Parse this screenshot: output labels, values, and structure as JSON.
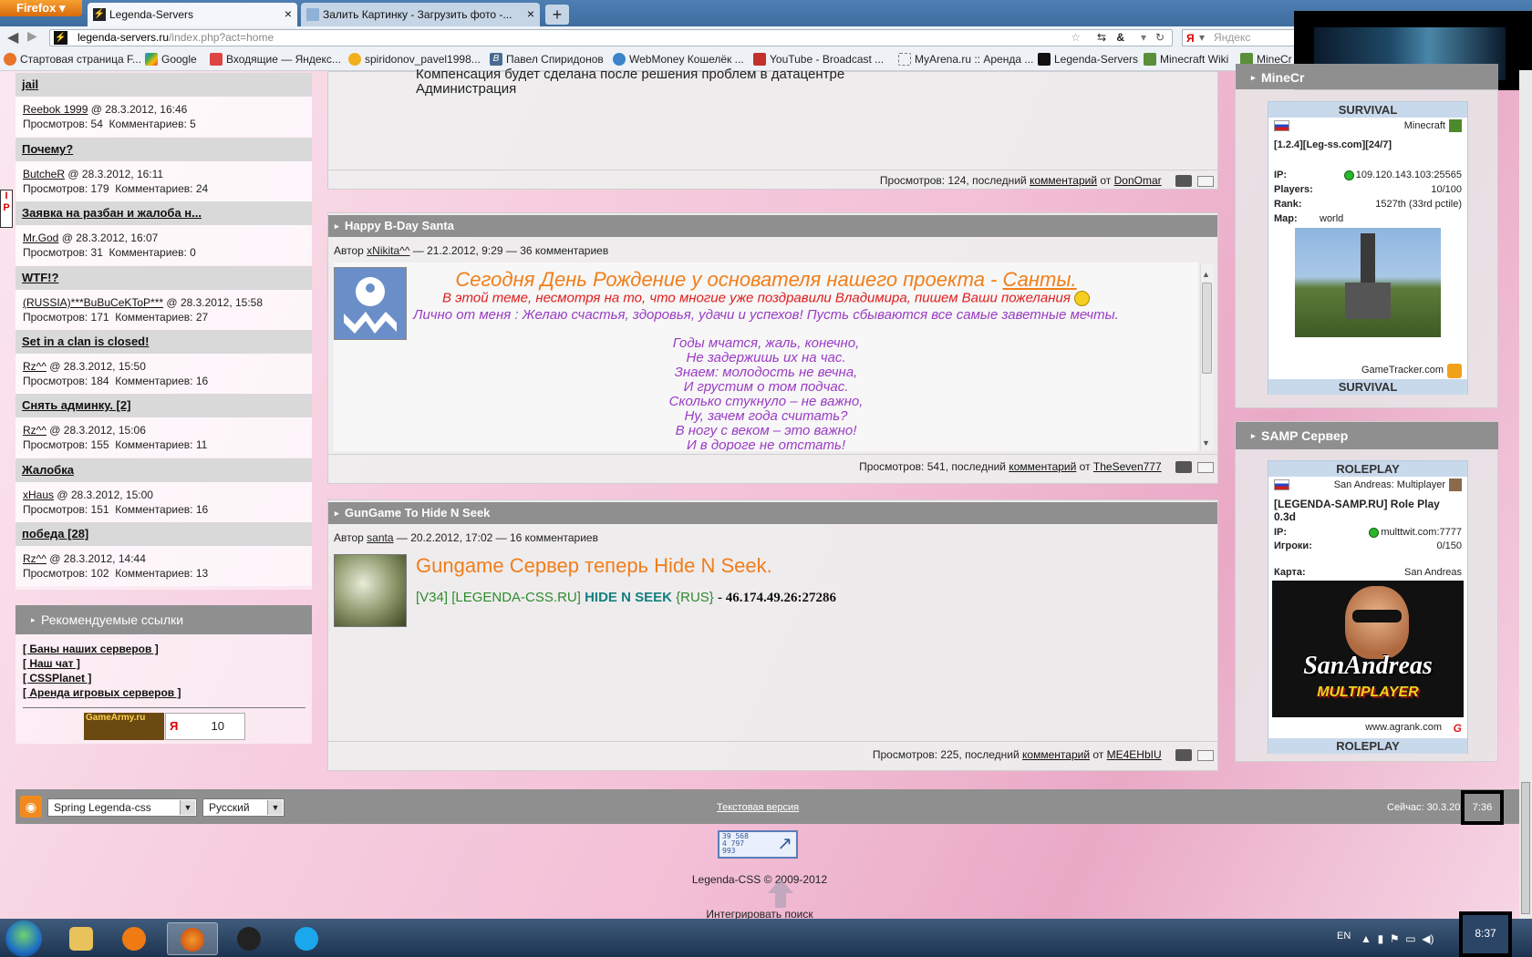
{
  "browser": {
    "firefox_label": "Firefox",
    "tabs": [
      {
        "title": "Legenda-Servers"
      },
      {
        "title": "Залить Картинку - Загрузить фото -..."
      }
    ],
    "url_host": "legenda-servers.ru",
    "url_path": "/index.php?act=home",
    "search_placeholder": "Яндекс",
    "bookmarks": [
      "Стартовая страница F...",
      "Google",
      "Входящие — Яндекс...",
      "spiridonov_pavel1998...",
      "Павел Спиридонов",
      "WebMoney Кошелёк ...",
      "YouTube - Broadcast ...",
      "MyArena.ru :: Аренда ...",
      "Legenda-Servers",
      "Minecraft Wiki",
      "MineCr"
    ]
  },
  "left": {
    "topics": [
      {
        "title": "jail",
        "author": "Reebok 1999",
        "date": "@ 28.3.2012, 16:46",
        "views": "Просмотров: 54",
        "comments": "Комментариев: 5"
      },
      {
        "title": "Почему?",
        "author": "ButcheR",
        "date": "@ 28.3.2012, 16:11",
        "views": "Просмотров: 179",
        "comments": "Комментариев: 24"
      },
      {
        "title": "Заявка на разбан и жалоба н...",
        "author": "Mr.God",
        "date": "@ 28.3.2012, 16:07",
        "views": "Просмотров: 31",
        "comments": "Комментариев: 0"
      },
      {
        "title": "WTF!?",
        "author": "(RUSSIA)***BuBuCeKToP***",
        "date": "@ 28.3.2012, 15:58",
        "views": "Просмотров: 171",
        "comments": "Комментариев: 27"
      },
      {
        "title": "Set in a clan is closed!",
        "author": "Rz^^",
        "date": "@ 28.3.2012, 15:50",
        "views": "Просмотров: 184",
        "comments": "Комментариев: 16"
      },
      {
        "title": "Снять админку. [2]",
        "author": "Rz^^",
        "date": "@ 28.3.2012, 15:06",
        "views": "Просмотров: 155",
        "comments": "Комментариев: 11"
      },
      {
        "title": "Жалобка",
        "author": "xHaus",
        "date": "@ 28.3.2012, 15:00",
        "views": "Просмотров: 151",
        "comments": "Комментариев: 16"
      },
      {
        "title": "победа [28]",
        "author": "Rz^^",
        "date": "@ 28.3.2012, 14:44",
        "views": "Просмотров: 102",
        "comments": "Комментариев: 13"
      }
    ],
    "recommended_title": "Рекомендуемые ссылки",
    "links": [
      "[ Баны наших серверов ]",
      "[ Наш чат ]",
      "[ CSSPlanet ]",
      "[ Аренда игровых серверов ]"
    ],
    "counter_gamearmy": "GameArmy.ru",
    "counter_num": "10"
  },
  "center": {
    "post1": {
      "line1": "Компенсация будет сделана после решения проблем в датацентре",
      "line2": "Администрация",
      "views": "Просмотров: 124, последний",
      "comment_link": "комментарий",
      "from": "от",
      "last_user": "DonOmar"
    },
    "post2": {
      "title": "Happy B-Day Santa",
      "author_label": "Автор",
      "author": "xNikita^^",
      "meta": "— 21.2.2012, 9:29 — 36 комментариев",
      "headline": "Сегодня День Рождение у основателя нашего проекта -",
      "headline_link": "Санты.",
      "red_line": "В этой теме, несмотря на то, что многие уже поздравили Владимира, пишем Ваши пожелания",
      "purple_line": "Лично от меня : Желаю счастья, здоровья, удачи и успехов! Пусть сбываются все самые заветные мечты.",
      "poem": [
        "Годы мчатся, жаль, конечно,",
        "Не задержишь их на час.",
        "Знаем: молодость не вечна,",
        "И грустим о том подчас.",
        "Сколько стукнуло – не важно,",
        "Ну, зачем года считать?",
        "В ногу с веком – это важно!",
        "И в дороге не отстать!"
      ],
      "views": "Просмотров: 541, последний",
      "comment_link": "комментарий",
      "from": "от",
      "last_user": "TheSeven777"
    },
    "post3": {
      "title": "GunGame To Hide N Seek",
      "author_label": "Автор",
      "author": "santa",
      "meta": "— 20.2.2012, 17:02 — 16 комментариев",
      "headline": "Gungame Сервер теперь Hide N Seek.",
      "tag1": "[V34]",
      "tag2": "[LEGENDA-CSS.RU]",
      "tag3": "HIDE N SEEK",
      "tag4": "{RUS}",
      "address": "- 46.174.49.26:27286",
      "views": "Просмотров: 225, последний",
      "comment_link": "комментарий",
      "from": "от",
      "last_user": "ME4EHbIU"
    }
  },
  "right": {
    "mc_head": "MineCr",
    "mc": {
      "title": "SURVIVAL",
      "game": "Minecraft",
      "name": "[1.2.4][Leg-ss.com][24/7]",
      "ip_label": "IP:",
      "ip": "109.120.143.103:25565",
      "players_label": "Players:",
      "players": "10/100",
      "rank_label": "Rank:",
      "rank": "1527th (33rd pctile)",
      "map_label": "Map:",
      "map": "world",
      "tracker": "GameTracker.com",
      "footer": "SURVIVAL"
    },
    "samp_head": "SAMP Сервер",
    "samp": {
      "title": "ROLEPLAY",
      "game": "San Andreas: Multiplayer",
      "name": "[LEGENDA-SAMP.RU] Role Play 0.3d",
      "ip_label": "IP:",
      "ip": "multtwit.com:7777",
      "players_label": "Игроки:",
      "players": "0/150",
      "map_label": "Карта:",
      "map": "San Andreas",
      "logo1": "SanAndreas",
      "logo2": "MULTIPLAYER",
      "tracker": "www.agrank.com",
      "footer": "ROLEPLAY"
    }
  },
  "footer": {
    "theme_select": "Spring Legenda-css",
    "lang_select": "Русский",
    "text_version": "Текстовая версия",
    "now": "Сейчас: 30.3.201",
    "time": "7:36",
    "counter_lines": [
      "39 568",
      "4 797",
      "993"
    ],
    "copyright": "Legenda-CSS © 2009-2012",
    "integrate_search": "Интегрировать поиск"
  },
  "taskbar": {
    "lang": "EN",
    "clock": "8:37"
  },
  "colors": {
    "panel_head": "#8f8f8f",
    "orange": "#f07e1a",
    "red": "#e01d1d",
    "purple": "#9a3cc4",
    "teal": "#138080"
  }
}
